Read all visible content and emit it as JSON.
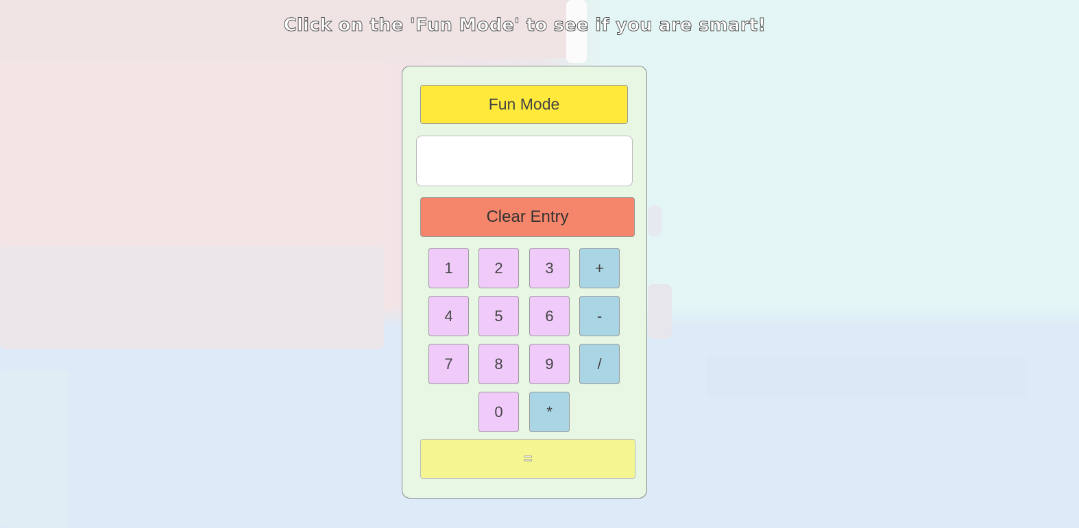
{
  "page": {
    "headline": "Click on the 'Fun Mode' to see if you are smart!"
  },
  "calculator": {
    "fun_mode_label": "Fun Mode",
    "display_value": "",
    "clear_label": "Clear Entry",
    "equals_label": "=",
    "keys": {
      "k1": "1",
      "k2": "2",
      "k3": "3",
      "plus": "+",
      "k4": "4",
      "k5": "5",
      "k6": "6",
      "minus": "-",
      "k7": "7",
      "k8": "8",
      "k9": "9",
      "divide": "/",
      "k0": "0",
      "multiply": "*"
    }
  },
  "colors": {
    "panel": "#e8f6e4",
    "fun_mode": "#ffea3b",
    "clear": "#f5866b",
    "number_key": "#f0cbfa",
    "operator_key": "#a9d5e5",
    "equals": "#f4f791"
  }
}
